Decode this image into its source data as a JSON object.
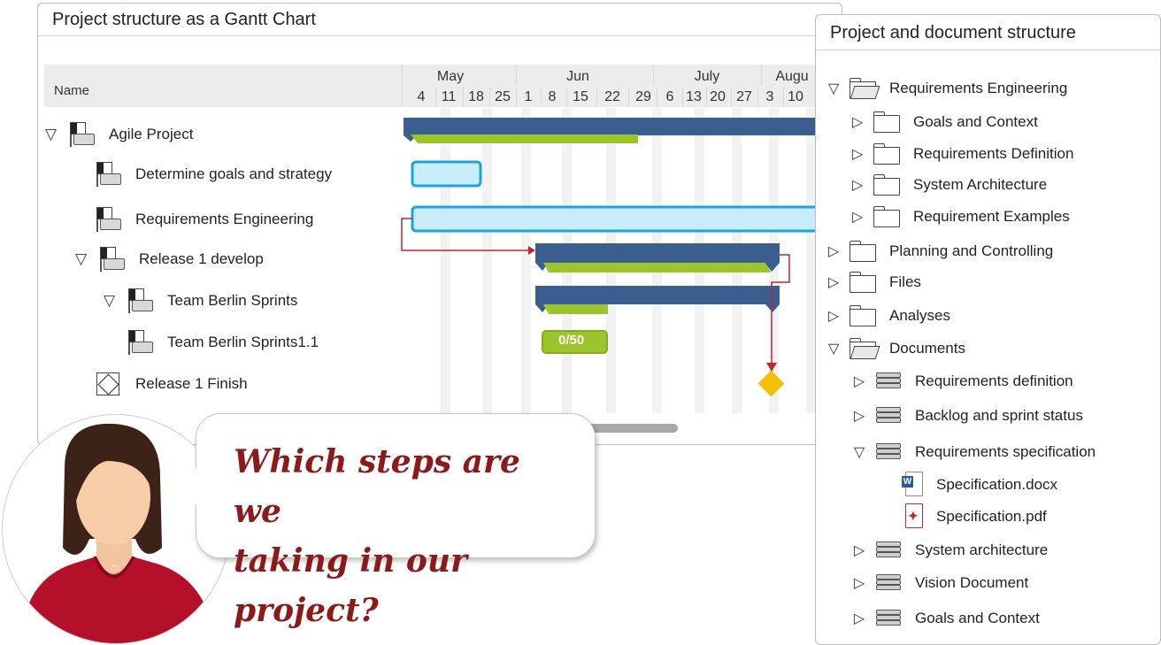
{
  "gantt": {
    "title": "Project structure as a Gantt Chart",
    "name_header": "Name",
    "months": [
      "May",
      "Jun",
      "July",
      "Augu"
    ],
    "days": [
      "4",
      "11",
      "18",
      "25",
      "1",
      "8",
      "15",
      "22",
      "29",
      "6",
      "13",
      "20",
      "27",
      "3",
      "10"
    ],
    "rows": [
      {
        "label": "Agile Project",
        "type": "summary",
        "expanded": true,
        "level": 0
      },
      {
        "label": "Determine goals and strategy",
        "type": "task",
        "level": 1
      },
      {
        "label": "Requirements Engineering",
        "type": "task",
        "level": 1
      },
      {
        "label": "Release 1 develop",
        "type": "summary",
        "expanded": true,
        "level": 1
      },
      {
        "label": "Team Berlin Sprints",
        "type": "summary",
        "expanded": true,
        "level": 2
      },
      {
        "label": "Team Berlin Sprints1.1",
        "type": "task",
        "level": 3
      },
      {
        "label": "Release 1 Finish",
        "type": "milestone",
        "level": 1
      }
    ],
    "sprint_progress_label": "0/50",
    "colors": {
      "summary": "#3a5f8f",
      "progress": "#9cc42c",
      "task_fill": "#c9ecfa",
      "task_border": "#1aa3dc",
      "milestone": "#f5c000",
      "link": "#c0272d"
    }
  },
  "structure": {
    "title": "Project and document structure",
    "items": [
      {
        "label": "Requirements Engineering",
        "icon": "folder-open-icon",
        "expanded": true,
        "level": 0
      },
      {
        "label": "Goals and Context",
        "icon": "folder-icon",
        "expanded": false,
        "level": 1
      },
      {
        "label": "Requirements Definition",
        "icon": "folder-icon",
        "expanded": false,
        "level": 1
      },
      {
        "label": "System Architecture",
        "icon": "folder-icon",
        "expanded": false,
        "level": 1
      },
      {
        "label": "Requirement Examples",
        "icon": "folder-icon",
        "expanded": false,
        "level": 1
      },
      {
        "label": "Planning and Controlling",
        "icon": "folder-icon",
        "expanded": false,
        "level": 0
      },
      {
        "label": "Files",
        "icon": "folder-icon",
        "expanded": false,
        "level": 0
      },
      {
        "label": "Analyses",
        "icon": "folder-icon",
        "expanded": false,
        "level": 0
      },
      {
        "label": "Documents",
        "icon": "folder-open-icon",
        "expanded": true,
        "level": 0
      },
      {
        "label": "Requirements definition",
        "icon": "stack-icon",
        "expanded": false,
        "level": 1
      },
      {
        "label": "Backlog and sprint status",
        "icon": "stack-icon",
        "expanded": false,
        "level": 1
      },
      {
        "label": "Requirements specification",
        "icon": "stack-icon",
        "expanded": true,
        "level": 1
      },
      {
        "label": "Specification.docx",
        "icon": "word-file-icon",
        "level": 2
      },
      {
        "label": "Specification.pdf",
        "icon": "pdf-file-icon",
        "level": 2
      },
      {
        "label": "System architecture",
        "icon": "stack-icon",
        "expanded": false,
        "level": 1
      },
      {
        "label": "Vision Document",
        "icon": "stack-icon",
        "expanded": false,
        "level": 1
      },
      {
        "label": "Goals and Context",
        "icon": "stack-icon",
        "expanded": false,
        "level": 1
      }
    ]
  },
  "speech": {
    "line1": "Which steps are we",
    "line2": "taking in our project?"
  }
}
